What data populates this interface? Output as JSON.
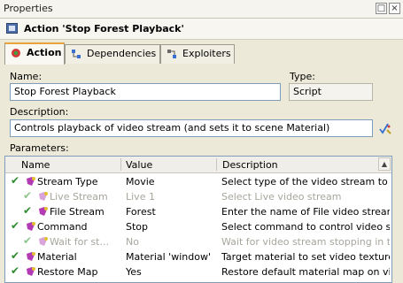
{
  "window": {
    "title": "Properties"
  },
  "header": {
    "title": "Action 'Stop Forest Playback'"
  },
  "tabs": [
    {
      "label": "Action",
      "icon": "action-icon",
      "active": true
    },
    {
      "label": "Dependencies",
      "icon": "dependencies-icon",
      "active": false
    },
    {
      "label": "Exploiters",
      "icon": "exploiters-icon",
      "active": false
    }
  ],
  "form": {
    "name_label": "Name:",
    "name_value": "Stop Forest Playback",
    "type_label": "Type:",
    "type_value": "Script",
    "description_label": "Description:",
    "description_value": "Controls playback of video stream (and sets it to scene Material)",
    "parameters_label": "Parameters:"
  },
  "grid": {
    "columns": [
      "Name",
      "Value",
      "Description"
    ],
    "rows": [
      {
        "name": "Stream Type",
        "value": "Movie",
        "description": "Select type of the video stream to c...",
        "indent": 0,
        "disabled": false
      },
      {
        "name": "Live Stream",
        "value": "Live 1",
        "description": "Select Live video stream",
        "indent": 1,
        "disabled": true
      },
      {
        "name": "File Stream",
        "value": "Forest",
        "description": "Enter the name of File video stream",
        "indent": 1,
        "disabled": false
      },
      {
        "name": "Command",
        "value": "Stop",
        "description": "Select command to control video str...",
        "indent": 0,
        "disabled": false
      },
      {
        "name": "Wait for st...",
        "value": "No",
        "description": "Wait for video stream stopping in th...",
        "indent": 1,
        "disabled": true
      },
      {
        "name": "Material",
        "value": "Material 'window'",
        "description": "Target material to set video texture",
        "indent": 0,
        "disabled": false
      },
      {
        "name": "Restore Map",
        "value": "Yes",
        "description": "Restore default material map on vid...",
        "indent": 0,
        "disabled": false
      }
    ]
  },
  "colors": {
    "check": "#2e8b2e",
    "param_icon": "#b23ab2",
    "tab_accent": "#e8a33c"
  }
}
